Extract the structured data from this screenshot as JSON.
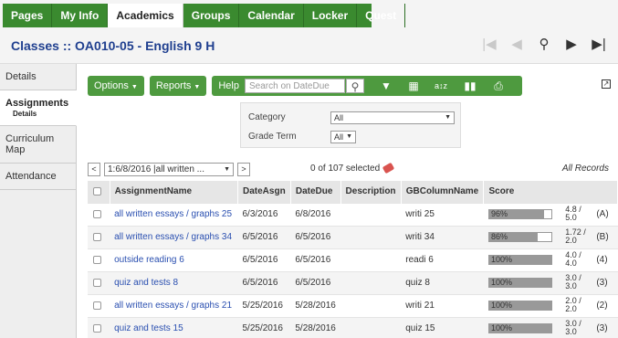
{
  "topnav": {
    "tabs": [
      {
        "label": "Pages",
        "active": false
      },
      {
        "label": "My Info",
        "active": false
      },
      {
        "label": "Academics",
        "active": true
      },
      {
        "label": "Groups",
        "active": false
      },
      {
        "label": "Calendar",
        "active": false
      },
      {
        "label": "Locker",
        "active": false
      },
      {
        "label": "Quest",
        "active": false
      }
    ],
    "accent": "#3a8a2f"
  },
  "header": {
    "title": "Classes :: OA010-05 - English 9 H",
    "title_color": "#1f3f8f",
    "nav_icons": [
      "first-record-icon",
      "previous-record-icon",
      "search-icon",
      "next-record-icon",
      "last-record-icon"
    ]
  },
  "sidebar": {
    "items": [
      {
        "label": "Details",
        "sub": ""
      },
      {
        "label": "Assignments",
        "sub": "Details"
      },
      {
        "label": "Curriculum Map",
        "sub": ""
      },
      {
        "label": "Attendance",
        "sub": ""
      }
    ]
  },
  "toolbar": {
    "options": "Options",
    "reports": "Reports",
    "help": "Help",
    "search_placeholder": "Search on DateDue",
    "icons": [
      "search-icon",
      "filter-icon",
      "grid-icon",
      "sort-az-icon",
      "chart-icon",
      "print-icon"
    ]
  },
  "filters": {
    "category_label": "Category",
    "category_value": "All",
    "term_label": "Grade Term",
    "term_value": "All"
  },
  "pager": {
    "prev": "<",
    "next": ">",
    "select_value": "1:6/8/2016 |all written ...",
    "selected_text": "0 of 107 selected",
    "all_records": "All Records"
  },
  "table": {
    "columns": [
      "AssignmentName",
      "DateAsgn",
      "DateDue",
      "Description",
      "GBColumnName",
      "Score"
    ],
    "rows": [
      {
        "name": "all written essays / graphs 25",
        "asgn": "6/3/2016",
        "due": "6/8/2016",
        "desc": "",
        "gb": "writi 25",
        "score_text": "96%",
        "score_pct": 96,
        "frac_top": "4.8 /",
        "frac_bot": "5.0",
        "letter": "(A)"
      },
      {
        "name": "all written essays / graphs 34",
        "asgn": "6/5/2016",
        "due": "6/5/2016",
        "desc": "",
        "gb": "writi 34",
        "score_text": "86%",
        "score_pct": 86,
        "frac_top": "1.72 /",
        "frac_bot": "2.0",
        "letter": "(B)"
      },
      {
        "name": "outside reading 6",
        "asgn": "6/5/2016",
        "due": "6/5/2016",
        "desc": "",
        "gb": "readi 6",
        "score_text": "100%",
        "score_pct": 100,
        "frac_top": "4.0 /",
        "frac_bot": "4.0",
        "letter": "(4)"
      },
      {
        "name": "quiz and tests 8",
        "asgn": "6/5/2016",
        "due": "6/5/2016",
        "desc": "",
        "gb": "quiz 8",
        "score_text": "100%",
        "score_pct": 100,
        "frac_top": "3.0 /",
        "frac_bot": "3.0",
        "letter": "(3)"
      },
      {
        "name": "all written essays / graphs 21",
        "asgn": "5/25/2016",
        "due": "5/28/2016",
        "desc": "",
        "gb": "writi 21",
        "score_text": "100%",
        "score_pct": 100,
        "frac_top": "2.0 /",
        "frac_bot": "2.0",
        "letter": "(2)"
      },
      {
        "name": "quiz and tests 15",
        "asgn": "5/25/2016",
        "due": "5/28/2016",
        "desc": "",
        "gb": "quiz 15",
        "score_text": "100%",
        "score_pct": 100,
        "frac_top": "3.0 /",
        "frac_bot": "3.0",
        "letter": "(3)"
      }
    ]
  }
}
